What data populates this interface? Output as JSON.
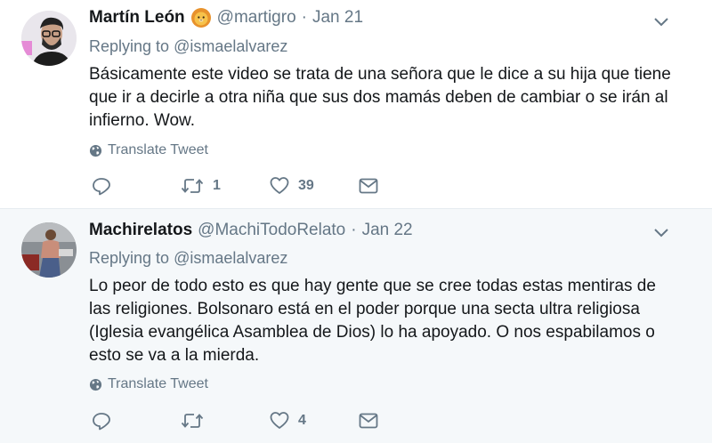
{
  "tweets": [
    {
      "name": "Martín León",
      "emoji_icon": "lion-face-icon",
      "handle": "@martigro",
      "date": "Jan 21",
      "replying_prefix": "Replying to ",
      "replying_to": "@ismaelalvarez",
      "text": "Básicamente este video se trata de una señora que le dice a su hija que tiene que ir a decirle a otra niña que sus dos mamás deben de cambiar o se irán al infierno. Wow.",
      "translate_label": "Translate Tweet",
      "retweets": "1",
      "likes": "39"
    },
    {
      "name": "Machirelatos",
      "handle": "@MachiTodoRelato",
      "date": "Jan 22",
      "replying_prefix": "Replying to ",
      "replying_to": "@ismaelalvarez",
      "text": "Lo peor de todo esto es que hay gente que se cree todas estas mentiras  de las religiones. Bolsonaro está en el poder porque una secta ultra religiosa (Iglesia evangélica Asamblea de Dios) lo ha apoyado.  O nos espabilamos o esto se va a la mierda.",
      "translate_label": "Translate Tweet",
      "retweets": "",
      "likes": "4"
    }
  ],
  "colors": {
    "text": "#14171a",
    "secondary": "#657786",
    "divider": "#e6ecf0",
    "alt_background": "#f5f8fa"
  }
}
